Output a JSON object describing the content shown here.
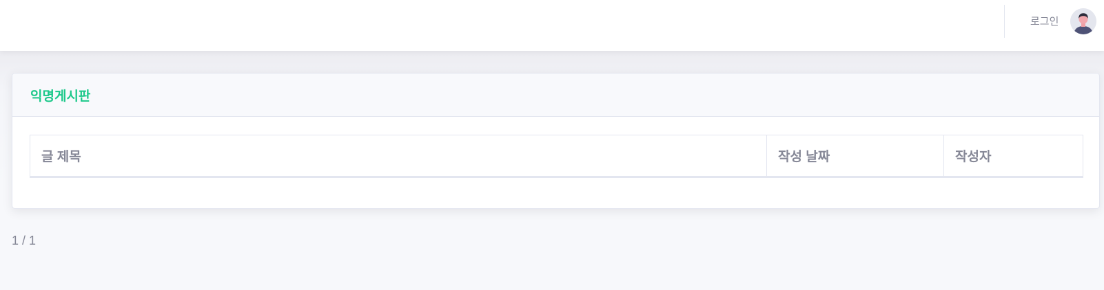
{
  "header": {
    "login_label": "로그인",
    "avatar_icon": "user-avatar-icon"
  },
  "board": {
    "title": "익명게시판",
    "accent_color": "#1cc88a",
    "columns": [
      "글 제목",
      "작성 날짜",
      "작성자"
    ],
    "rows": []
  },
  "pagination": {
    "text": "1 / 1"
  }
}
